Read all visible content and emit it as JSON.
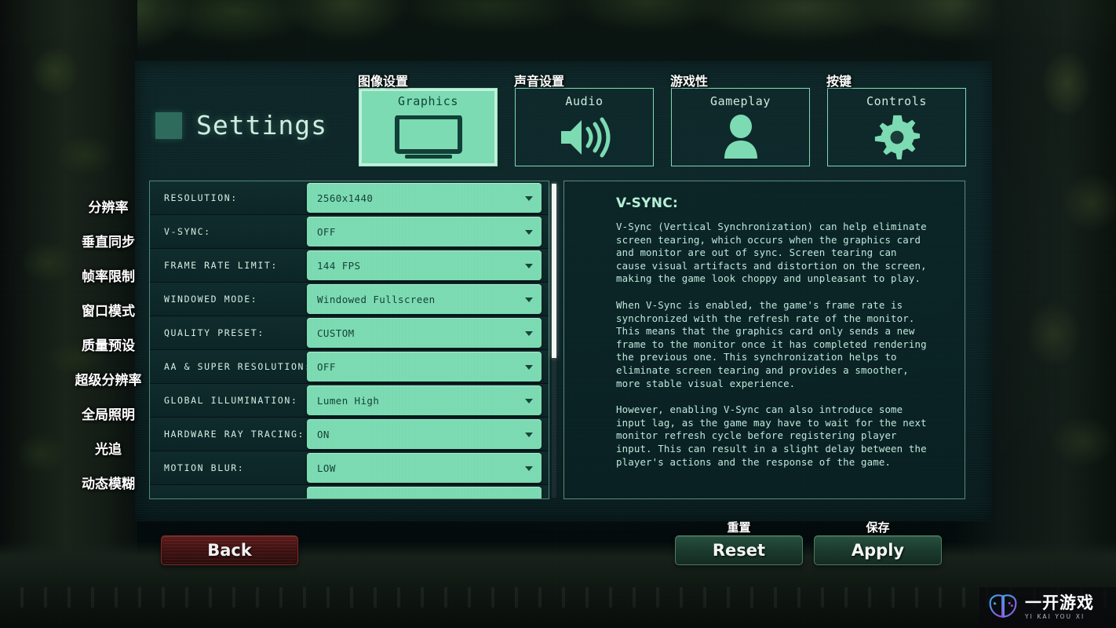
{
  "header": {
    "title": "Settings"
  },
  "tabs": [
    {
      "label": "Graphics",
      "cn": "图像设置",
      "icon": "monitor-icon",
      "active": true
    },
    {
      "label": "Audio",
      "cn": "声音设置",
      "icon": "speaker-icon",
      "active": false
    },
    {
      "label": "Gameplay",
      "cn": "游戏性",
      "icon": "person-icon",
      "active": false
    },
    {
      "label": "Controls",
      "cn": "按键",
      "icon": "gear-icon",
      "active": false
    }
  ],
  "settings": {
    "rows": [
      {
        "label": "RESOLUTION:",
        "value": "2560x1440",
        "cn": "分辨率"
      },
      {
        "label": "V-SYNC:",
        "value": "OFF",
        "cn": "垂直同步"
      },
      {
        "label": "FRAME RATE LIMIT:",
        "value": "144 FPS",
        "cn": "帧率限制"
      },
      {
        "label": "WINDOWED MODE:",
        "value": "Windowed Fullscreen",
        "cn": "窗口模式"
      },
      {
        "label": "QUALITY PRESET:",
        "value": "CUSTOM",
        "cn": "质量预设"
      },
      {
        "label": "AA & SUPER RESOLUTION:",
        "value": "OFF",
        "cn": "超级分辨率"
      },
      {
        "label": "GLOBAL ILLUMINATION:",
        "value": "Lumen High",
        "cn": "全局照明"
      },
      {
        "label": "HARDWARE RAY TRACING:",
        "value": "ON",
        "cn": "光追"
      },
      {
        "label": "MOTION BLUR:",
        "value": "LOW",
        "cn": "动态模糊"
      },
      {
        "label": "",
        "value": "",
        "cn": ""
      }
    ]
  },
  "description": {
    "title": "V-SYNC:",
    "paragraphs": [
      "V-Sync (Vertical Synchronization) can help eliminate\nscreen tearing, which occurs when the graphics card\nand monitor are out of sync. Screen tearing can\ncause visual artifacts and distortion on the screen,\nmaking the game look choppy and unpleasant to play.",
      "When V-Sync is enabled, the game's frame rate is\nsynchronized with the refresh rate of the monitor.\nThis means that the graphics card only sends a new\nframe to the monitor once it has completed rendering\nthe previous one. This synchronization helps to\neliminate screen tearing and provides a smoother,\nmore stable visual experience.",
      "However, enabling V-Sync can also introduce some\ninput lag, as the game may have to wait for the next\nmonitor refresh cycle before registering player\ninput. This can result in a slight delay between the\nplayer's actions and the response of the game."
    ]
  },
  "sidebar": {
    "items": [
      {
        "label": "分辨率"
      },
      {
        "label": "垂直同步"
      },
      {
        "label": "帧率限制"
      },
      {
        "label": "窗口模式"
      },
      {
        "label": "质量预设"
      },
      {
        "label": "超级分辨率"
      },
      {
        "label": "全局照明"
      },
      {
        "label": "光追"
      },
      {
        "label": "动态模糊"
      }
    ]
  },
  "footer": {
    "back_label": "Back",
    "reset_label": "Reset",
    "reset_cn": "重置",
    "apply_label": "Apply",
    "apply_cn": "保存"
  },
  "watermark": {
    "cn": "一开游戏",
    "en": "YI KAI YOU XI"
  },
  "colors": {
    "mint": "#7cdbb2",
    "panel_bg": "#0e282a",
    "text_light": "#bfe9dc",
    "back_red": "#3f1111",
    "green_btn": "#1b3b2e"
  }
}
